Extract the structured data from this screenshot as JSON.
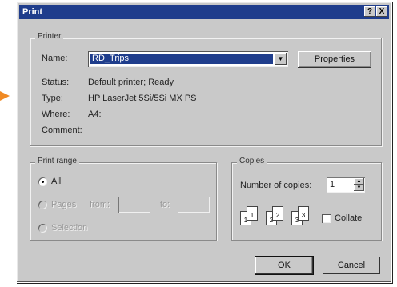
{
  "dialog": {
    "title": "Print",
    "help_button": "?",
    "close_button": "X"
  },
  "printer": {
    "group_label": "Printer",
    "name_label": "Name:",
    "name_value": "RD_Trips",
    "properties_button": "Properties",
    "status_label": "Status:",
    "status_value": "Default printer; Ready",
    "type_label": "Type:",
    "type_value": "HP LaserJet 5Si/5Si MX PS",
    "where_label": "Where:",
    "where_value": "A4:",
    "comment_label": "Comment:"
  },
  "print_range": {
    "group_label": "Print range",
    "all_label": "All",
    "pages_label": "Pages",
    "from_label": "from:",
    "to_label": "to:",
    "selection_label": "Selection"
  },
  "copies": {
    "group_label": "Copies",
    "number_label": "Number of copies:",
    "number_value": "1",
    "collate_label": "Collate",
    "collate_checked": false,
    "page_icons": [
      "1",
      "1",
      "2",
      "2",
      "3",
      "3"
    ]
  },
  "buttons": {
    "ok": "OK",
    "cancel": "Cancel"
  }
}
